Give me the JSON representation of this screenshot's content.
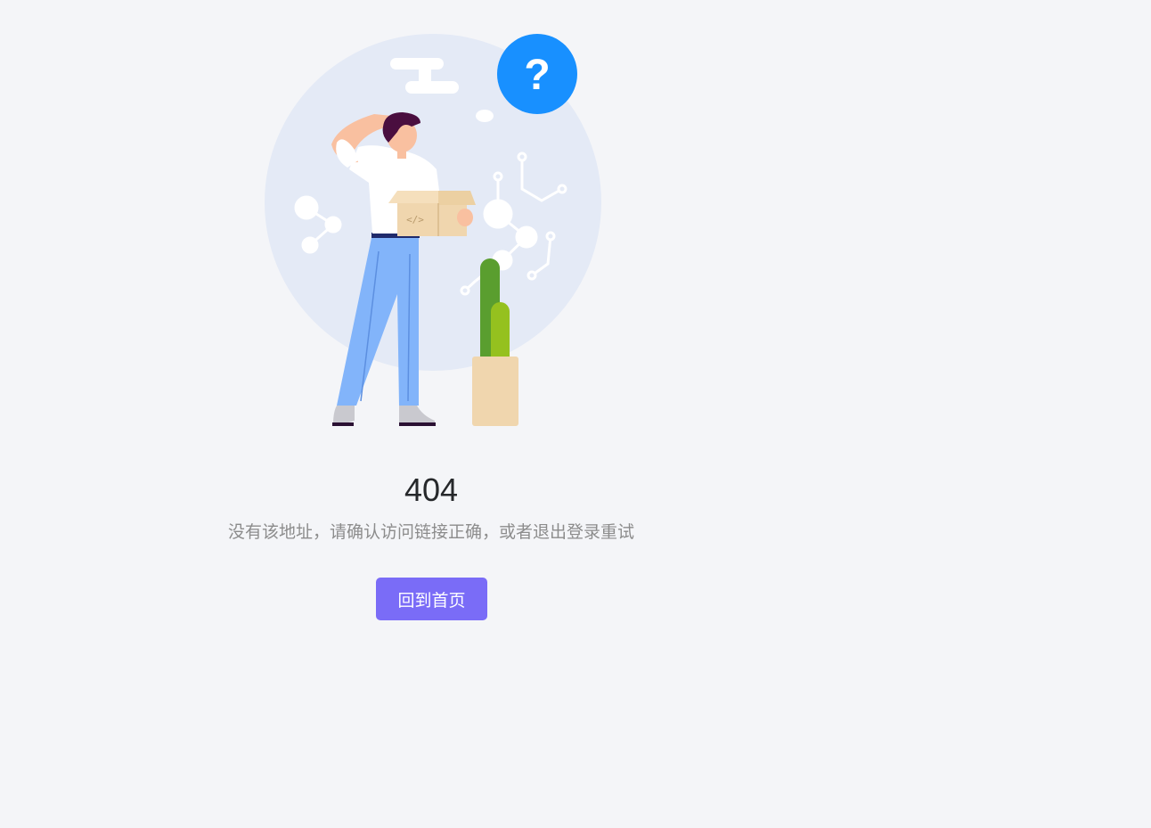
{
  "error": {
    "code": "404",
    "message": "没有该地址，请确认访问链接正确，或者退出登录重试",
    "question_mark": "?"
  },
  "actions": {
    "home_label": "回到首页"
  },
  "colors": {
    "background": "#f4f5f8",
    "accent_button": "#7a6cf7",
    "question_badge": "#1890ff",
    "backdrop_circle": "#e4eaf6"
  }
}
